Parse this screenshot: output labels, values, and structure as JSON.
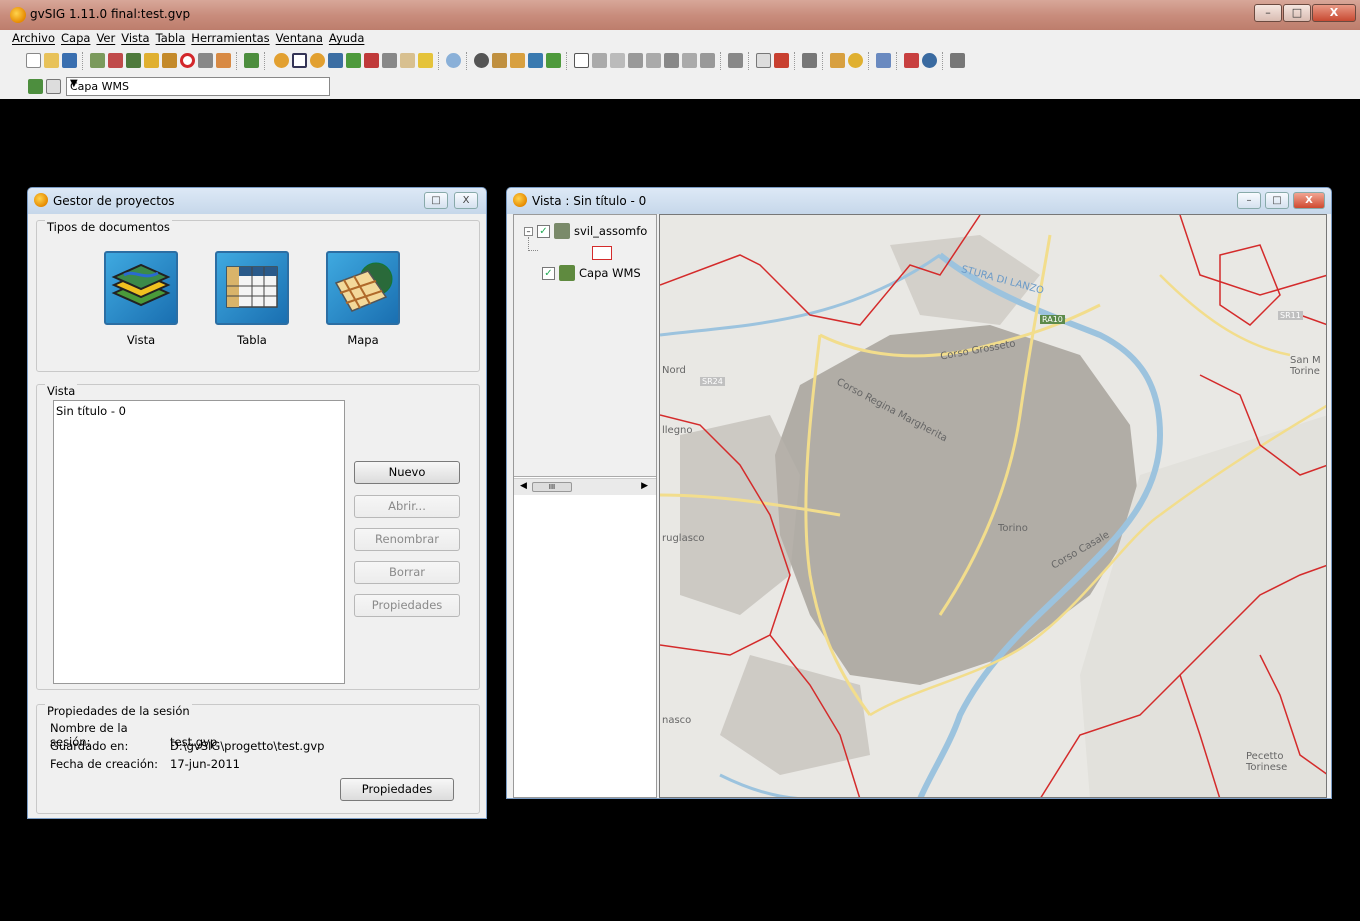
{
  "app": {
    "title": "gvSIG 1.11.0 final:test.gvp"
  },
  "window_buttons": {
    "minimize": "–",
    "maximize": "□",
    "close": "X"
  },
  "menubar": {
    "items": [
      "Archivo",
      "Capa",
      "Ver",
      "Vista",
      "Tabla",
      "Herramientas",
      "Ventana",
      "Ayuda"
    ]
  },
  "toolbar": {
    "layer_combo_value": "Capa WMS",
    "combo_arrow": "▼"
  },
  "gestor": {
    "title": "Gestor de proyectos",
    "doc_types_label": "Tipos de documentos",
    "doc_types": [
      {
        "label": "Vista",
        "icon": "vista-doc-icon"
      },
      {
        "label": "Tabla",
        "icon": "tabla-doc-icon"
      },
      {
        "label": "Mapa",
        "icon": "mapa-doc-icon"
      }
    ],
    "list_group_label": "Vista",
    "list_items": [
      "Sin título - 0"
    ],
    "buttons": {
      "nuevo": "Nuevo",
      "abrir": "Abrir...",
      "renombrar": "Renombrar",
      "borrar": "Borrar",
      "propiedades": "Propiedades"
    },
    "session": {
      "group_label": "Propiedades de la sesión",
      "name_key": "Nombre de la sesión:",
      "name_value": "test.gvp",
      "saved_key": "Guardado en:",
      "saved_value": "D:\\gvSIG\\progetto\\test.gvp",
      "date_key": "Fecha de creación:",
      "date_value": "17-jun-2011",
      "properties_button": "Propiedades"
    }
  },
  "vista": {
    "title": "Vista : Sin título - 0",
    "toc": {
      "layers": [
        {
          "name": "svil_assomfo",
          "checked": true
        },
        {
          "name": "Capa WMS",
          "checked": true
        }
      ],
      "expander": "–",
      "check_mark": "✓",
      "scroll_thumb": "III",
      "scroll_left": "◀",
      "scroll_right": "▶"
    },
    "map_labels": {
      "torino": "Torino",
      "corso_grosseto": "Corso Grosseto",
      "corso_regina": "Corso Regina Margherita",
      "stura": "STURA DI LANZO",
      "nord": "Nord",
      "llegno": "llegno",
      "grugliasco": "ruglasco",
      "nasco": "nasco",
      "pecetto": "Pecetto Torinese",
      "san_m": "San M Torine",
      "corso_casale": "Corso Casale",
      "a4": "RA10",
      "s11": "SR11",
      "s24": "SR24"
    },
    "colors": {
      "boundary": "#d42b2b",
      "main_road": "#f2dd8c",
      "river": "#9cc3de",
      "urban": "#9a9590",
      "land": "#e9e8e4"
    }
  }
}
